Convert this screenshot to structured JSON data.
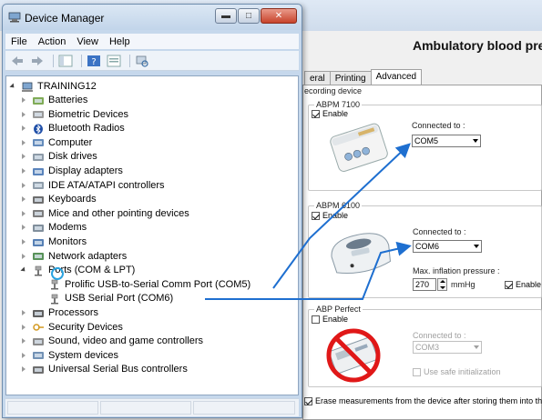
{
  "colors": {
    "arrow": "#1e6fd0",
    "window_frame": "#c6d8ec",
    "accent": "#3b7fd1"
  },
  "background_app": {
    "title": "Ambulatory blood pres",
    "tabs": [
      {
        "label": "eral",
        "active": false
      },
      {
        "label": "Printing",
        "active": false
      },
      {
        "label": "Advanced",
        "active": true
      }
    ],
    "section_label": "ecording device",
    "groups": [
      {
        "name": "ABPM 7100",
        "enable_label": "Enable",
        "enabled": true,
        "connected_label": "Connected to :",
        "port": "COM5"
      },
      {
        "name": "ABPM 6100",
        "enable_label": "Enable",
        "enabled": true,
        "connected_label": "Connected to :",
        "port": "COM6",
        "pressure_label": "Max. inflation pressure :",
        "pressure_value": "270",
        "pressure_unit": "mmHg",
        "extra_enable_label": "Enable"
      },
      {
        "name": "ABP Perfect",
        "enable_label": "Enable",
        "enabled": false,
        "connected_label": "Connected to :",
        "port": "COM3",
        "safe_init_label": "Use safe initialization"
      }
    ],
    "erase_label": "Erase measurements from the device after storing them into the d"
  },
  "device_manager": {
    "title": "Device Manager",
    "menu": [
      "File",
      "Action",
      "View",
      "Help"
    ],
    "tree": {
      "root": "TRAINING12",
      "items": [
        {
          "label": "Batteries",
          "icon": "battery-icon"
        },
        {
          "label": "Biometric Devices",
          "icon": "fingerprint-icon"
        },
        {
          "label": "Bluetooth Radios",
          "icon": "bluetooth-icon"
        },
        {
          "label": "Computer",
          "icon": "computer-icon"
        },
        {
          "label": "Disk drives",
          "icon": "disk-icon"
        },
        {
          "label": "Display adapters",
          "icon": "display-icon"
        },
        {
          "label": "IDE ATA/ATAPI controllers",
          "icon": "ide-icon"
        },
        {
          "label": "Keyboards",
          "icon": "keyboard-icon"
        },
        {
          "label": "Mice and other pointing devices",
          "icon": "mouse-icon"
        },
        {
          "label": "Modems",
          "icon": "modem-icon"
        },
        {
          "label": "Monitors",
          "icon": "monitor-icon"
        },
        {
          "label": "Network adapters",
          "icon": "network-icon"
        },
        {
          "label": "Ports (COM & LPT)",
          "icon": "port-icon",
          "expanded": true
        },
        {
          "label": "Prolific USB-to-Serial Comm Port (COM5)",
          "icon": "port-icon",
          "child": true
        },
        {
          "label": "USB Serial Port (COM6)",
          "icon": "port-icon",
          "child": true
        },
        {
          "label": "Processors",
          "icon": "processor-icon"
        },
        {
          "label": "Security Devices",
          "icon": "security-icon"
        },
        {
          "label": "Sound, video and game controllers",
          "icon": "sound-icon"
        },
        {
          "label": "System devices",
          "icon": "system-icon"
        },
        {
          "label": "Universal Serial Bus controllers",
          "icon": "usb-icon"
        }
      ]
    }
  }
}
